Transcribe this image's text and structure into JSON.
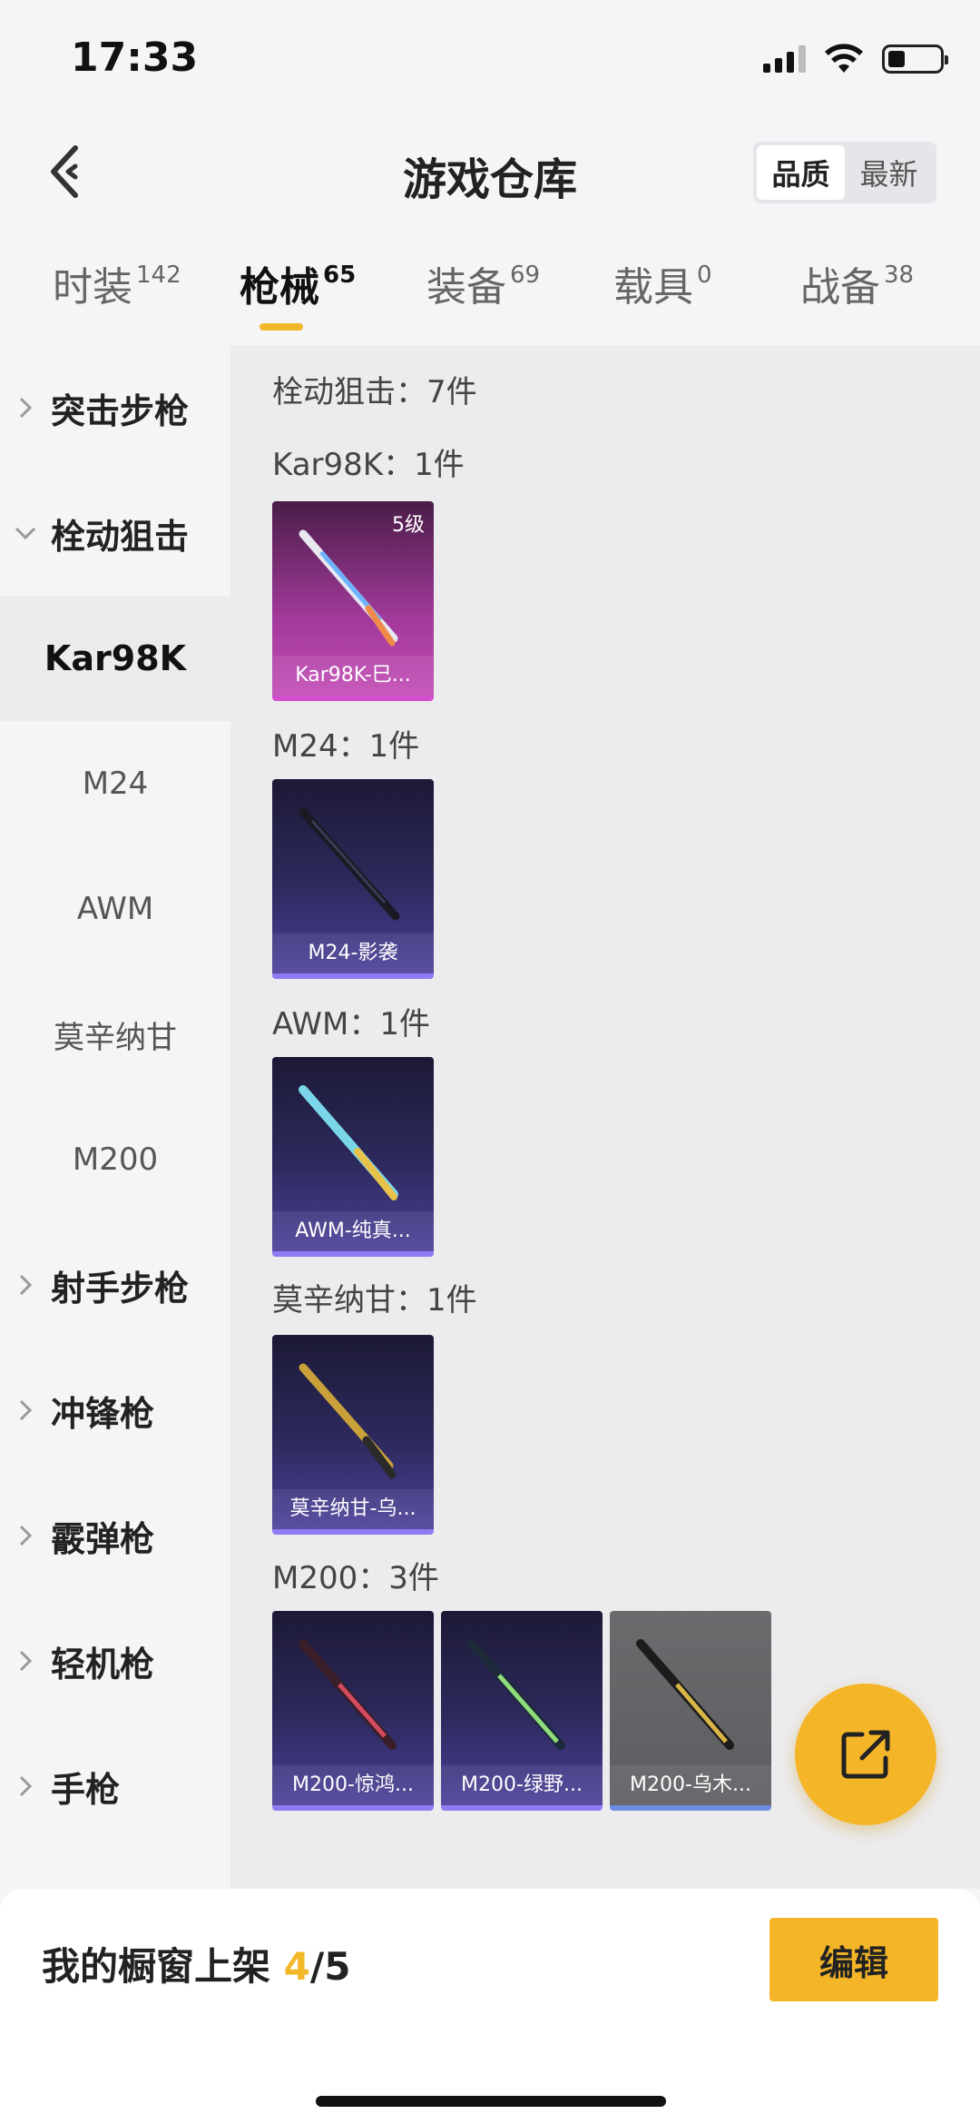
{
  "status": {
    "time": "17:33"
  },
  "header": {
    "title": "游戏仓库",
    "sort_quality": "品质",
    "sort_newest": "最新"
  },
  "tabs": [
    {
      "label": "时装",
      "count": "142"
    },
    {
      "label": "枪械",
      "count": "65"
    },
    {
      "label": "装备",
      "count": "69"
    },
    {
      "label": "载具",
      "count": "0"
    },
    {
      "label": "战备",
      "count": "38"
    }
  ],
  "sidebar": {
    "assault_rifle": "突击步枪",
    "bolt_sniper": "栓动狙击",
    "sub_kar98k": "Kar98K",
    "sub_m24": "M24",
    "sub_awm": "AWM",
    "sub_mosin": "莫辛纳甘",
    "sub_m200": "M200",
    "dmr": "射手步枪",
    "smg": "冲锋枪",
    "shotgun": "霰弹枪",
    "lmg": "轻机枪",
    "pistol": "手枪"
  },
  "content": {
    "section_title": "栓动狙击：7件",
    "groups": [
      {
        "title": "Kar98K：1件",
        "items": [
          {
            "name": "Kar98K-巳...",
            "level": "5级"
          }
        ]
      },
      {
        "title": "M24：1件",
        "items": [
          {
            "name": "M24-影袭"
          }
        ]
      },
      {
        "title": "AWM：1件",
        "items": [
          {
            "name": "AWM-纯真..."
          }
        ]
      },
      {
        "title": "莫辛纳甘：1件",
        "items": [
          {
            "name": "莫辛纳甘-乌..."
          }
        ]
      },
      {
        "title": "M200：3件",
        "items": [
          {
            "name": "M200-惊鸿..."
          },
          {
            "name": "M200-绿野..."
          },
          {
            "name": "M200-乌木..."
          }
        ]
      }
    ]
  },
  "bottom": {
    "showcase_label": "我的橱窗上架",
    "showcase_count": "4",
    "showcase_total": "/5",
    "edit_label": "编辑"
  },
  "colors": {
    "accent": "#f3b827",
    "pink_rarity": "#c24bb6",
    "purple_rarity": "#4b3f9a",
    "gray_rarity": "#5d5d61"
  },
  "icons": {
    "back": "back-arrow-icon",
    "share": "share-icon",
    "chevron_right": "chevron-right-icon",
    "chevron_down": "chevron-down-icon",
    "gun": "rifle-icon"
  }
}
